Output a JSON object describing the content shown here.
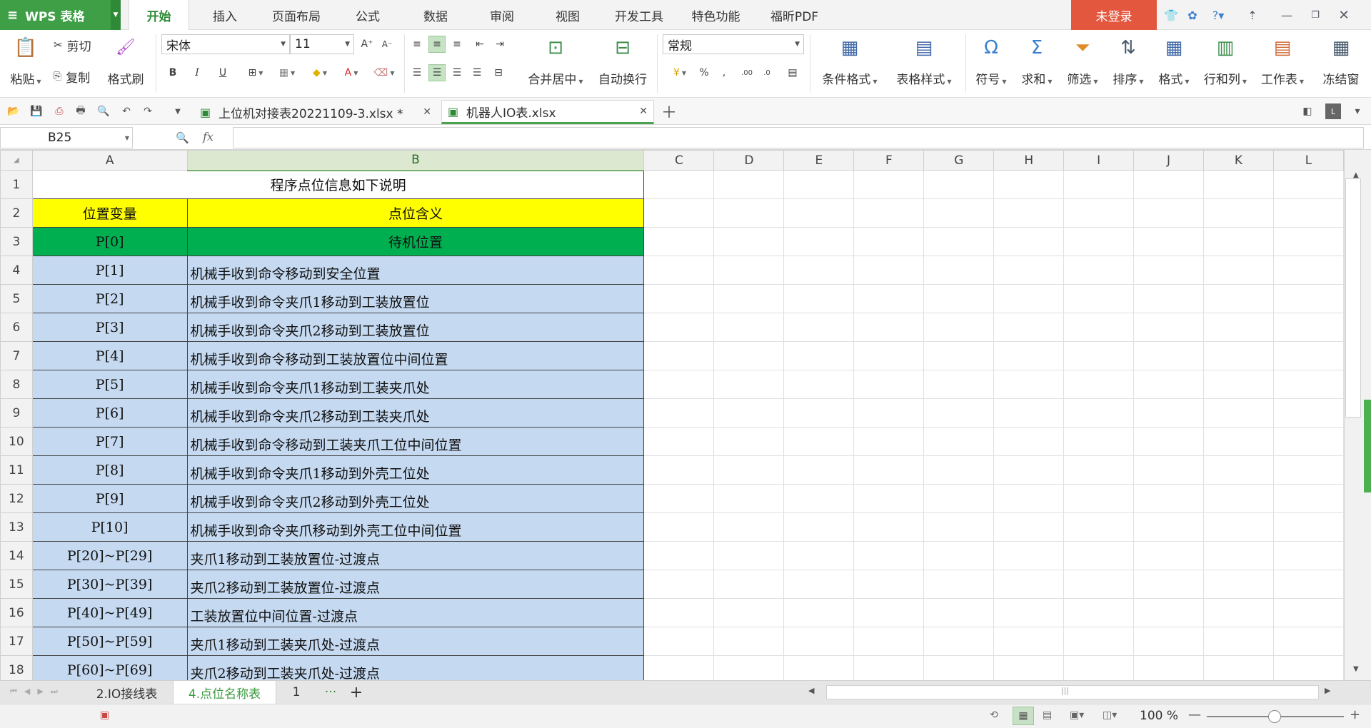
{
  "app": {
    "logo": "WPS 表格",
    "login": "未登录"
  },
  "menu": [
    "开始",
    "插入",
    "页面布局",
    "公式",
    "数据",
    "审阅",
    "视图",
    "开发工具",
    "特色功能",
    "福昕PDF"
  ],
  "ribbon": {
    "paste": "粘贴",
    "cut": "剪切",
    "copy": "复制",
    "format_painter": "格式刷",
    "font_name": "宋体",
    "font_size": "11",
    "merge_center": "合并居中",
    "wrap_text": "自动换行",
    "number_format": "常规",
    "conditional_format": "条件格式",
    "table_style": "表格样式",
    "symbol": "符号",
    "sum": "求和",
    "filter": "筛选",
    "sort": "排序",
    "format": "格式",
    "row_col": "行和列",
    "worksheet": "工作表",
    "freeze": "冻结窗"
  },
  "docs": [
    {
      "name": "上位机对接表20221109-3.xlsx *",
      "active": false
    },
    {
      "name": "机器人IO表.xlsx",
      "active": true
    }
  ],
  "formula": {
    "cell_ref": "B25",
    "fx": "fx",
    "value": ""
  },
  "columns": [
    "A",
    "B",
    "C",
    "D",
    "E",
    "F",
    "G",
    "H",
    "I",
    "J",
    "K",
    "L"
  ],
  "rows": {
    "title": "程序点位信息如下说明",
    "header": [
      "位置变量",
      "点位含义"
    ],
    "standby": [
      "P[0]",
      "待机位置"
    ],
    "data": [
      [
        "P[1]",
        "机械手收到命令移动到安全位置"
      ],
      [
        "P[2]",
        "机械手收到命令夹爪1移动到工装放置位"
      ],
      [
        "P[3]",
        "机械手收到命令夹爪2移动到工装放置位"
      ],
      [
        "P[4]",
        "机械手收到命令移动到工装放置位中间位置"
      ],
      [
        "P[5]",
        "机械手收到命令夹爪1移动到工装夹爪处"
      ],
      [
        "P[6]",
        "机械手收到命令夹爪2移动到工装夹爪处"
      ],
      [
        "P[7]",
        "机械手收到命令移动到工装夹爪工位中间位置"
      ],
      [
        "P[8]",
        "机械手收到命令夹爪1移动到外壳工位处"
      ],
      [
        "P[9]",
        "机械手收到命令夹爪2移动到外壳工位处"
      ],
      [
        "P[10]",
        "机械手收到命令夹爪移动到外壳工位中间位置"
      ],
      [
        "P[20]~P[29]",
        "夹爪1移动到工装放置位-过渡点"
      ],
      [
        "P[30]~P[39]",
        "夹爪2移动到工装放置位-过渡点"
      ],
      [
        "P[40]~P[49]",
        "工装放置位中间位置-过渡点"
      ],
      [
        "P[50]~P[59]",
        "夹爪1移动到工装夹爪处-过渡点"
      ],
      [
        "P[60]~P[69]",
        "夹爪2移动到工装夹爪处-过渡点"
      ]
    ]
  },
  "sheets": [
    "2.IO接线表",
    "4.点位名称表",
    "1"
  ],
  "status": {
    "zoom": "100 %"
  }
}
